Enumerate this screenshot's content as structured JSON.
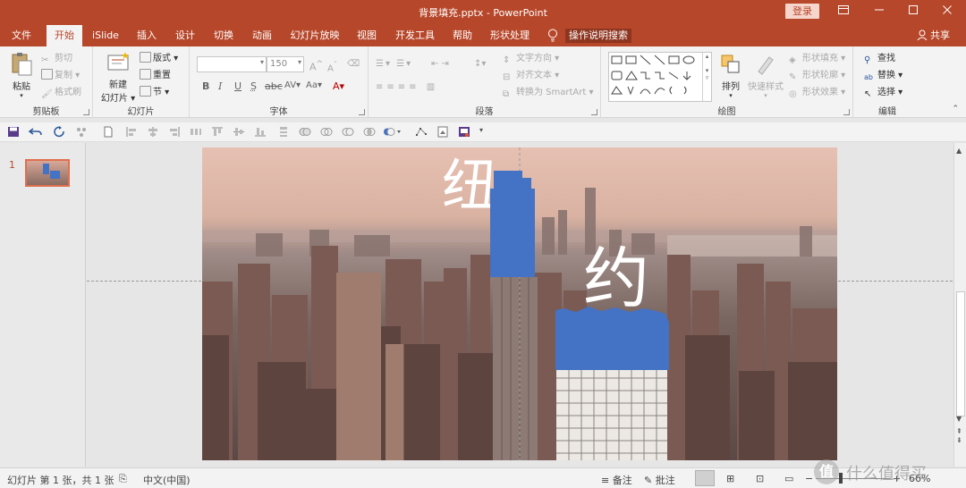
{
  "titlebar": {
    "title": "背景填充.pptx  -  PowerPoint",
    "login": "登录"
  },
  "tabs": [
    "文件",
    "开始",
    "iSlide",
    "插入",
    "设计",
    "切换",
    "动画",
    "幻灯片放映",
    "视图",
    "开发工具",
    "帮助",
    "形状处理"
  ],
  "tell_me": "操作说明搜索",
  "share": "共享",
  "ribbon": {
    "clipboard": {
      "paste": "粘贴",
      "cut": "剪切",
      "copy": "复制",
      "format_painter": "格式刷",
      "label": "剪贴板"
    },
    "slides": {
      "new_slide": "新建",
      "new_slide2": "幻灯片",
      "layout": "版式",
      "reset": "重置",
      "section": "节",
      "label": "幻灯片"
    },
    "font": {
      "size": "150",
      "label": "字体"
    },
    "paragraph": {
      "text_direction": "文字方向",
      "align_text": "对齐文本",
      "smartart": "转换为 SmartArt",
      "label": "段落"
    },
    "drawing": {
      "arrange": "排列",
      "quick_styles": "快速样式",
      "shape_fill": "形状填充",
      "shape_outline": "形状轮廓",
      "shape_effects": "形状效果",
      "label": "绘图"
    },
    "editing": {
      "find": "查找",
      "replace": "替换",
      "select": "选择",
      "label": "编辑"
    }
  },
  "slide": {
    "number": "1",
    "text_a": "纽",
    "text_b": "约"
  },
  "status": {
    "slide_info": "幻灯片 第 1 张，共 1 张",
    "language": "中文(中国)",
    "notes": "备注",
    "comments": "批注",
    "zoom": "66%",
    "watermark": "值 什么值得买"
  },
  "colors": {
    "brand": "#b7472a",
    "shape_fill": "#4472c4"
  }
}
